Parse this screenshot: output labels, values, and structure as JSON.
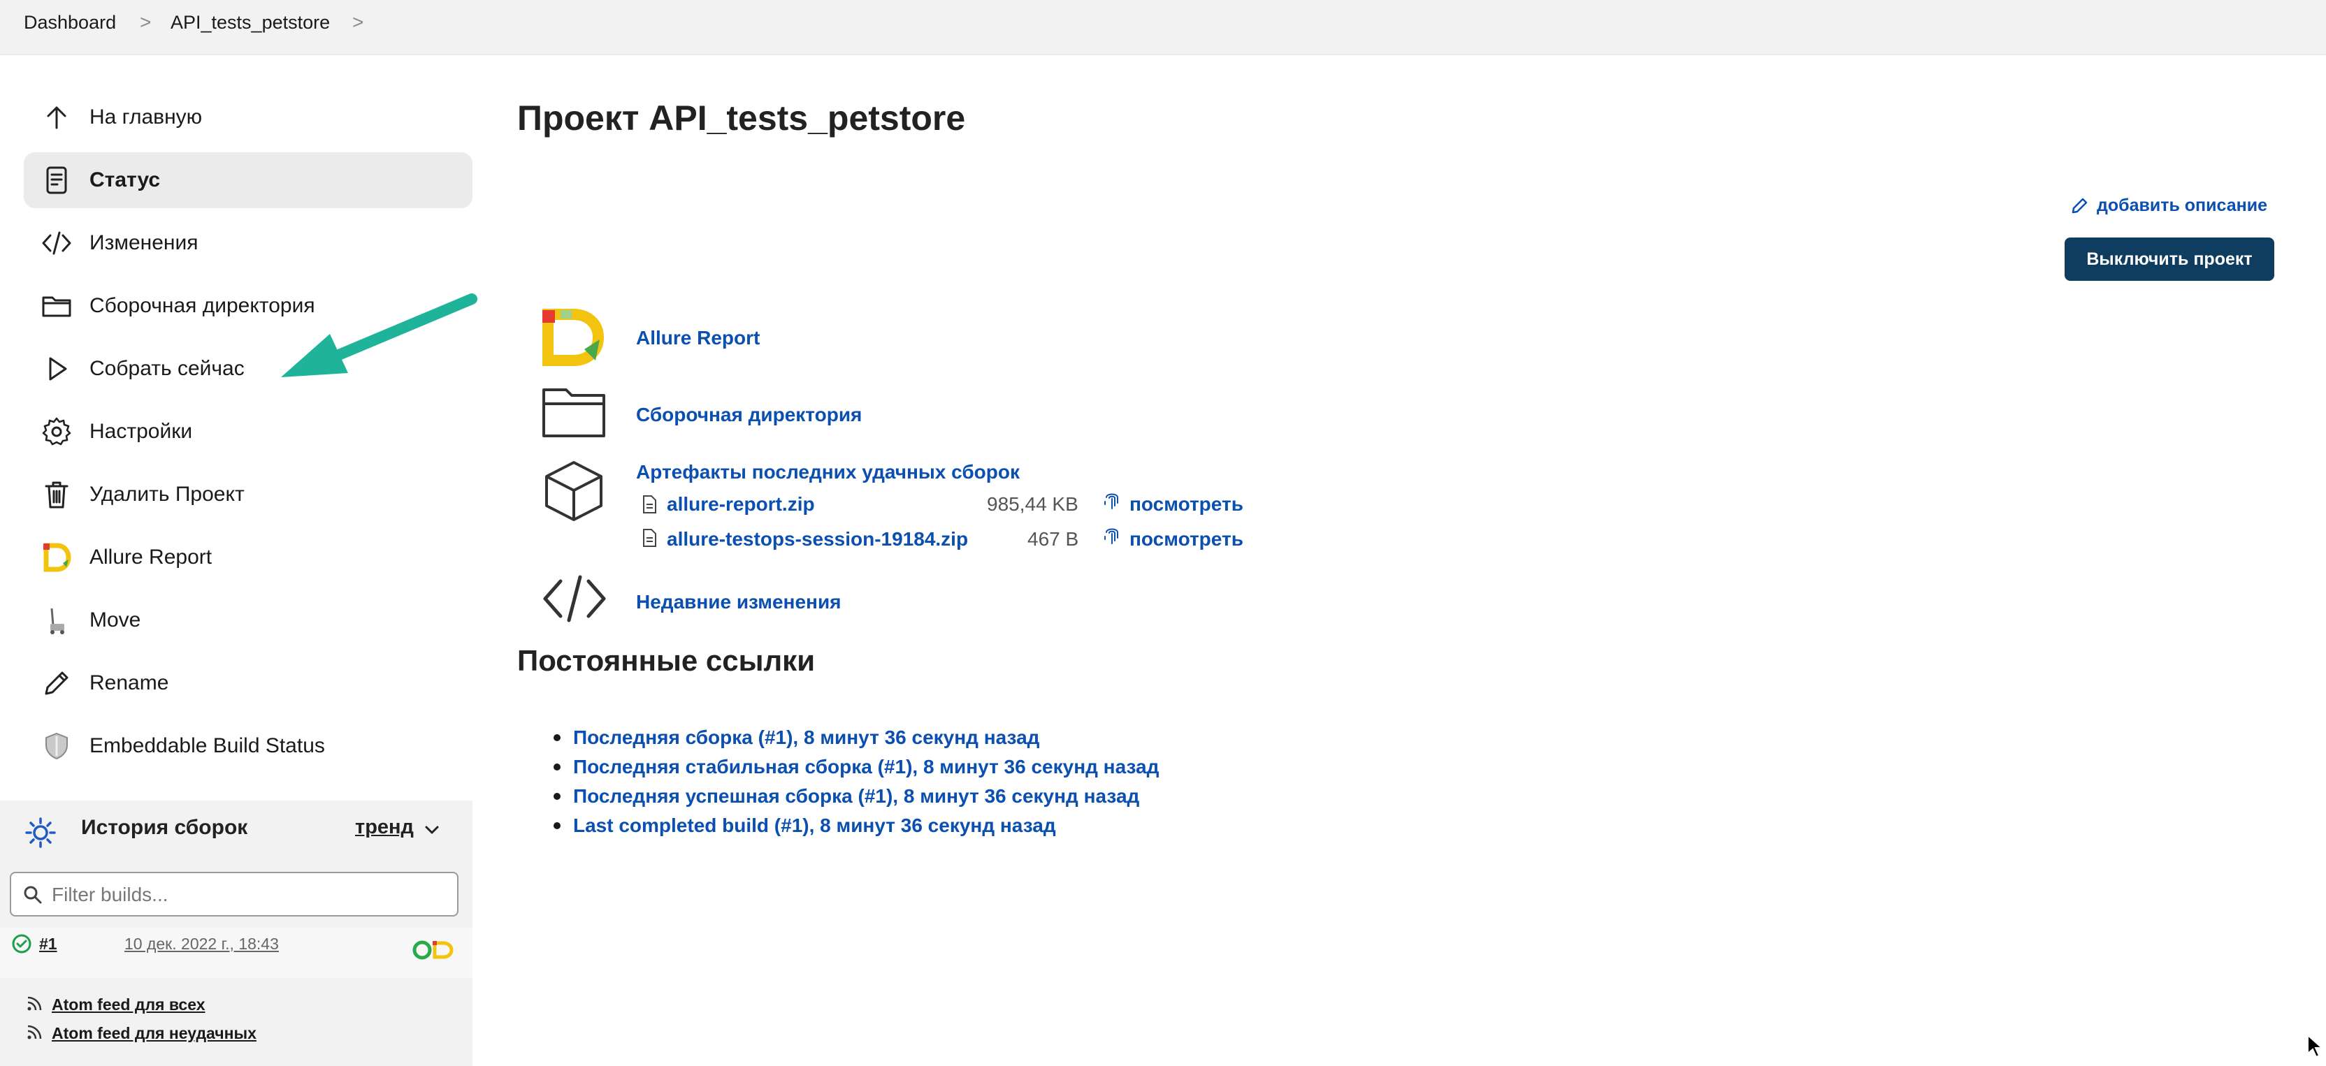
{
  "breadcrumb": {
    "items": [
      "Dashboard",
      "API_tests_petstore"
    ],
    "separator": ">"
  },
  "sidebar": {
    "items": [
      {
        "label": "На главную",
        "icon": "arrow-up-icon"
      },
      {
        "label": "Статус",
        "icon": "document-icon",
        "active": true
      },
      {
        "label": "Изменения",
        "icon": "code-icon"
      },
      {
        "label": "Сборочная директория",
        "icon": "folder-icon"
      },
      {
        "label": "Собрать сейчас",
        "icon": "play-icon"
      },
      {
        "label": "Настройки",
        "icon": "gear-icon"
      },
      {
        "label": "Удалить Проект",
        "icon": "trash-icon"
      },
      {
        "label": "Allure Report",
        "icon": "allure-logo-icon"
      },
      {
        "label": "Move",
        "icon": "move-icon"
      },
      {
        "label": "Rename",
        "icon": "pencil-icon"
      },
      {
        "label": "Embeddable Build Status",
        "icon": "shield-icon"
      }
    ]
  },
  "build_history": {
    "title": "История сборок",
    "trend_label": "тренд",
    "filter_placeholder": "Filter builds...",
    "builds": [
      {
        "number": "#1",
        "date": "10 дек. 2022 г., 18:43"
      }
    ],
    "feeds": [
      "Atom feed для всех",
      "Atom feed для неудачных"
    ]
  },
  "main": {
    "title": "Проект API_tests_petstore",
    "add_description": "добавить описание",
    "disable_button": "Выключить проект",
    "links": {
      "allure": "Allure Report",
      "workspace": "Сборочная директория",
      "artifacts": "Артефакты последних удачных сборок",
      "changes": "Недавние изменения"
    },
    "artifacts": [
      {
        "name": "allure-report.zip",
        "size": "985,44 KB",
        "action": "посмотреть"
      },
      {
        "name": "allure-testops-session-19184.zip",
        "size": "467 B",
        "action": "посмотреть"
      }
    ],
    "permalinks_title": "Постоянные ссылки",
    "permalinks": [
      "Последняя сборка (#1), 8 минут 36 секунд назад",
      "Последняя стабильная сборка (#1), 8 минут 36 секунд назад",
      "Последняя успешная сборка (#1), 8 минут 36 секунд назад",
      "Last completed build (#1), 8 минут 36 секунд назад"
    ]
  },
  "colors": {
    "accent_button": "#0f3d5f",
    "link": "#0b4fb0",
    "annotation_arrow": "#1fb39a",
    "success": "#1e9e4a"
  }
}
